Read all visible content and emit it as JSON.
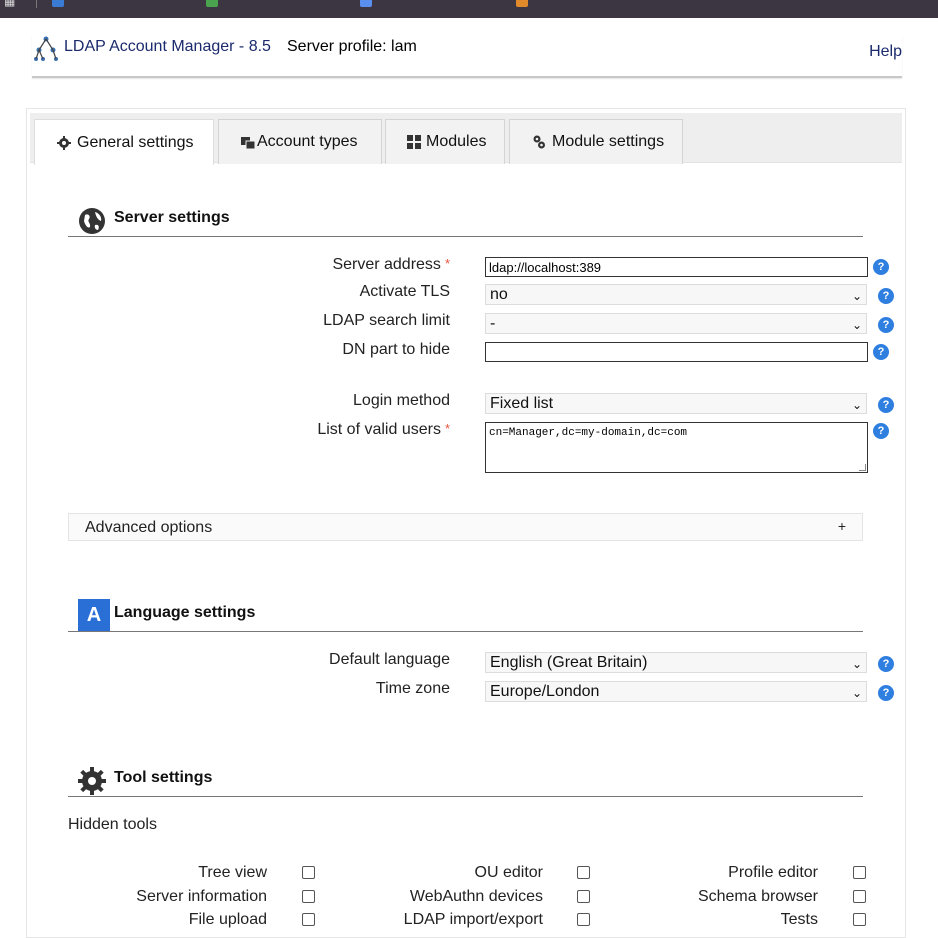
{
  "header": {
    "title": "LDAP Account Manager - 8.5",
    "server_profile": "Server profile: lam",
    "help": "Help"
  },
  "tabs": [
    {
      "label": "General settings",
      "icon": "gear-icon"
    },
    {
      "label": "Account types",
      "icon": "windows-icon"
    },
    {
      "label": "Modules",
      "icon": "grid-icon"
    },
    {
      "label": "Module settings",
      "icon": "gears-icon"
    }
  ],
  "server_settings": {
    "title": "Server settings",
    "server_address_label": "Server address",
    "server_address_value": "ldap://localhost:389",
    "activate_tls_label": "Activate TLS",
    "activate_tls_value": "no",
    "search_limit_label": "LDAP search limit",
    "search_limit_value": "-",
    "dn_hide_label": "DN part to hide",
    "dn_hide_value": "",
    "login_method_label": "Login method",
    "login_method_value": "Fixed list",
    "valid_users_label": "List of valid users",
    "valid_users_value": "cn=Manager,dc=my-domain,dc=com",
    "required_mark": "*",
    "help_mark": "?"
  },
  "advanced": {
    "label": "Advanced options",
    "toggle": "+"
  },
  "language_settings": {
    "title": "Language settings",
    "icon_letter": "A",
    "default_language_label": "Default language",
    "default_language_value": "English (Great Britain)",
    "time_zone_label": "Time zone",
    "time_zone_value": "Europe/London"
  },
  "tool_settings": {
    "title": "Tool settings",
    "hidden_tools_label": "Hidden tools",
    "tools": [
      "Tree view",
      "OU editor",
      "Profile editor",
      "Server information",
      "WebAuthn devices",
      "Schema browser",
      "File upload",
      "LDAP import/export",
      "Tests"
    ]
  },
  "colors": {
    "help": "#2f7fe0",
    "required": "#e5533d",
    "language_badge": "#2a6fd6"
  }
}
